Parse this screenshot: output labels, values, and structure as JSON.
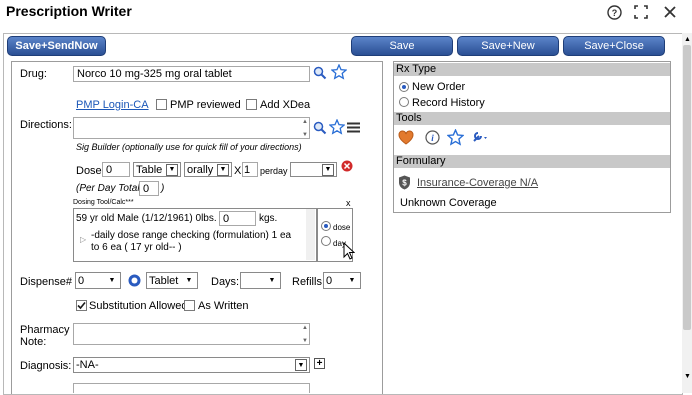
{
  "window": {
    "title": "Prescription Writer"
  },
  "toolbar": {
    "save_send_now": "Save+SendNow",
    "save": "Save",
    "save_new": "Save+New",
    "save_close": "Save+Close"
  },
  "form": {
    "drug_label": "Drug:",
    "drug_value": "Norco 10 mg-325 mg oral tablet",
    "pmp_login": "PMP Login-CA",
    "pmp_reviewed": "PMP reviewed",
    "add_xdea": "Add XDea",
    "directions_label": "Directions:",
    "sig_builder": "Sig Builder (optionally use for quick fill of your directions)",
    "dose_label": "Dose:",
    "dose_value": "0",
    "dose_form": "Table",
    "route": "orally",
    "x_label": "X",
    "times": "1",
    "perday": "perday",
    "per_day_total_label": "(Per Day Total:",
    "per_day_total_value": "0",
    "per_day_total_close": ")",
    "dosing_tool_label": "Dosing Tool/Calc***",
    "dosing_close": "x",
    "patient_info": "59 yr old Male (1/12/1961) 0lbs.",
    "kgs_value": "0",
    "kgs_label": "kgs.",
    "range_check": "-daily dose range checking (formulation) 1 ea to 6 ea ( 17 yr old-- )",
    "dose_option": "dose",
    "day_option": "day",
    "dispense_label": "Dispense#",
    "dispense_value": "0",
    "dispense_unit": "Tablet",
    "days_label": "Days:",
    "refills_label": "Refills:",
    "refills_value": "0",
    "substitution_allowed": "Substitution Allowed",
    "as_written": "As Written",
    "pharmacy_note_label_1": "Pharmacy",
    "pharmacy_note_label_2": "Note:",
    "diagnosis_label": "Diagnosis:",
    "diagnosis_value": "-NA-",
    "plus": "+"
  },
  "rx_type": {
    "header": "Rx Type",
    "new_order": "New Order",
    "record_history": "Record History"
  },
  "tools": {
    "header": "Tools"
  },
  "formulary": {
    "header": "Formulary",
    "insurance_link": "Insurance-Coverage N/A",
    "coverage": "Unknown Coverage"
  },
  "colors": {
    "accent": "#2a4f93",
    "link": "#1b57b8",
    "section_header": "#c8c8c8"
  }
}
